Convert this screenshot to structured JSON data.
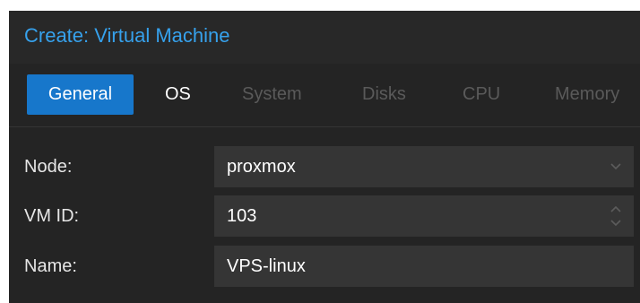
{
  "dialog": {
    "title": "Create: Virtual Machine"
  },
  "tabs": [
    {
      "label": "General",
      "state": "active"
    },
    {
      "label": "OS",
      "state": "enabled"
    },
    {
      "label": "System",
      "state": "disabled"
    },
    {
      "label": "Disks",
      "state": "disabled"
    },
    {
      "label": "CPU",
      "state": "disabled"
    },
    {
      "label": "Memory",
      "state": "disabled"
    }
  ],
  "form": {
    "node": {
      "label": "Node:",
      "value": "proxmox",
      "icon": "chevron-down-icon"
    },
    "vmid": {
      "label": "VM ID:",
      "value": "103",
      "icon": "spinner-arrows-icon"
    },
    "name": {
      "label": "Name:",
      "value": "VPS-linux"
    }
  },
  "colors": {
    "accent": "#1777cb",
    "title": "#36a1ec",
    "background": "#242424",
    "field": "#353535",
    "disabled_text": "#5a5a5a"
  }
}
